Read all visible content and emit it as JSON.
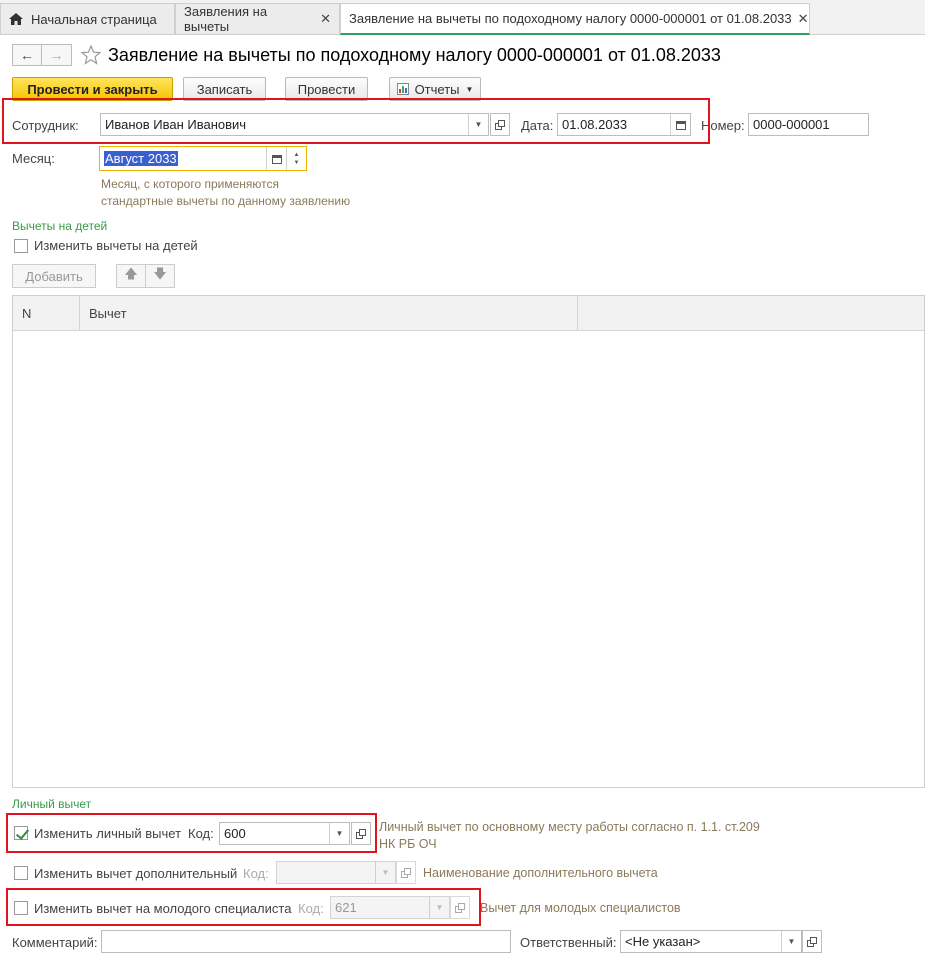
{
  "tabs": [
    {
      "label": "Начальная страница"
    },
    {
      "label": "Заявления на вычеты"
    },
    {
      "label": "Заявление на вычеты по подоходному налогу 0000-000001 от 01.08.2033"
    }
  ],
  "header": {
    "title": "Заявление на вычеты по подоходному налогу 0000-000001 от 01.08.2033"
  },
  "toolbar": {
    "post_close": "Провести и закрыть",
    "save": "Записать",
    "post": "Провести",
    "reports": "Отчеты"
  },
  "form": {
    "employee_label": "Сотрудник:",
    "employee_value": "Иванов Иван Иванович",
    "date_label": "Дата:",
    "date_value": "01.08.2033",
    "number_label": "Номер:",
    "number_value": "0000-000001",
    "month_label": "Месяц:",
    "month_value": "Август 2033",
    "month_hint_1": "Месяц, с которого применяются",
    "month_hint_2": "стандартные вычеты по данному заявлению"
  },
  "children": {
    "section_title": "Вычеты на детей",
    "change_label": "Изменить вычеты на детей",
    "change_checked": false,
    "add_button": "Добавить",
    "columns": [
      "N",
      "Вычет"
    ]
  },
  "personal": {
    "section_title": "Личный вычет",
    "personal_label": "Изменить личный вычет",
    "personal_checked": true,
    "code_label": "Код:",
    "personal_code": "600",
    "personal_desc_1": "Личный вычет по основному месту работы согласно п. 1.1. ст.209",
    "personal_desc_2": "НК РБ ОЧ",
    "additional_label": "Изменить вычет дополнительный",
    "additional_checked": false,
    "additional_code": "",
    "additional_desc": "Наименование дополнительного вычета",
    "young_label": "Изменить вычет на молодого специалиста",
    "young_checked": false,
    "young_code": "621",
    "young_desc": "Вычет для молодых специалистов"
  },
  "footer": {
    "comment_label": "Комментарий:",
    "comment_value": "",
    "responsible_label": "Ответственный:",
    "responsible_value": "<Не указан>"
  },
  "colors": {
    "accent_green": "#3a9a4a",
    "primary_yellow": "#f5c400",
    "highlight_red": "#e0141e",
    "focus_orange": "#f0b400"
  }
}
